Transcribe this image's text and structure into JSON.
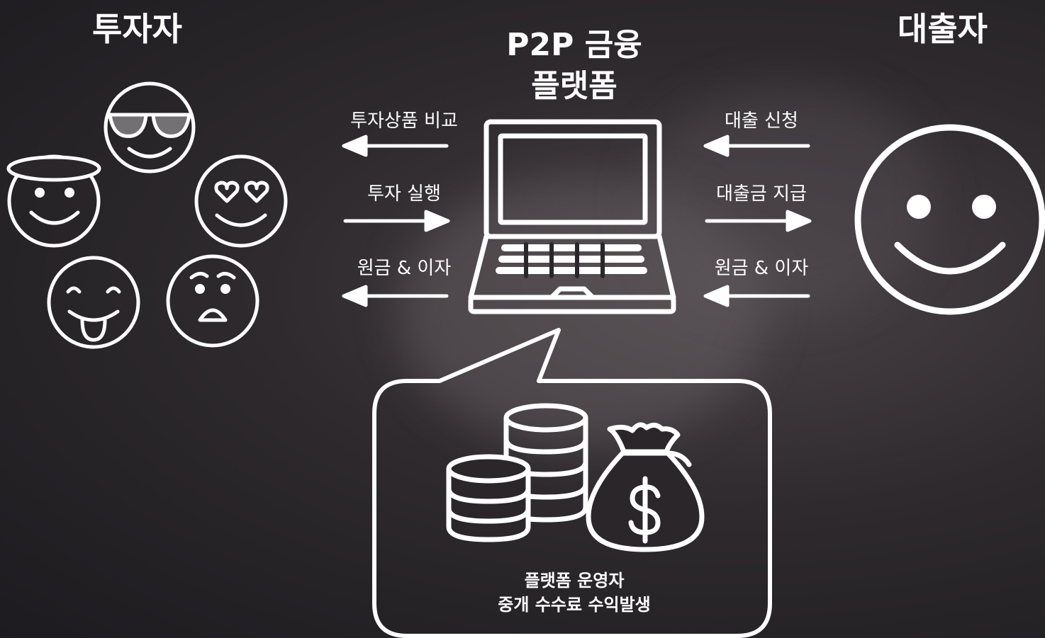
{
  "investor_title": "투자자",
  "borrower_title": "대출자",
  "platform_title_line1": "P2P 금융",
  "platform_title_line2": "플랫폼",
  "left_flows": [
    {
      "label": "투자상품 비교",
      "direction": "left"
    },
    {
      "label": "투자 실행",
      "direction": "right"
    },
    {
      "label": "원금 & 이자",
      "direction": "left"
    }
  ],
  "right_flows": [
    {
      "label": "대출 신청",
      "direction": "left"
    },
    {
      "label": "대출금 지급",
      "direction": "right"
    },
    {
      "label": "원금 & 이자",
      "direction": "left"
    }
  ],
  "operator_line1": "플랫폼 운영자",
  "operator_line2": "중개 수수료 수익발생",
  "investor_icons": [
    "sunglasses-face-icon",
    "angel-face-icon",
    "heart-eyes-face-icon",
    "tongue-face-icon",
    "surprised-face-icon"
  ],
  "borrower_icon": "smiley-face-icon",
  "platform_icon": "laptop-icon",
  "money_icons": [
    "coin-stack-icon",
    "money-bag-icon"
  ],
  "colors": {
    "foreground": "#ffffff",
    "background": "#2a262a"
  }
}
